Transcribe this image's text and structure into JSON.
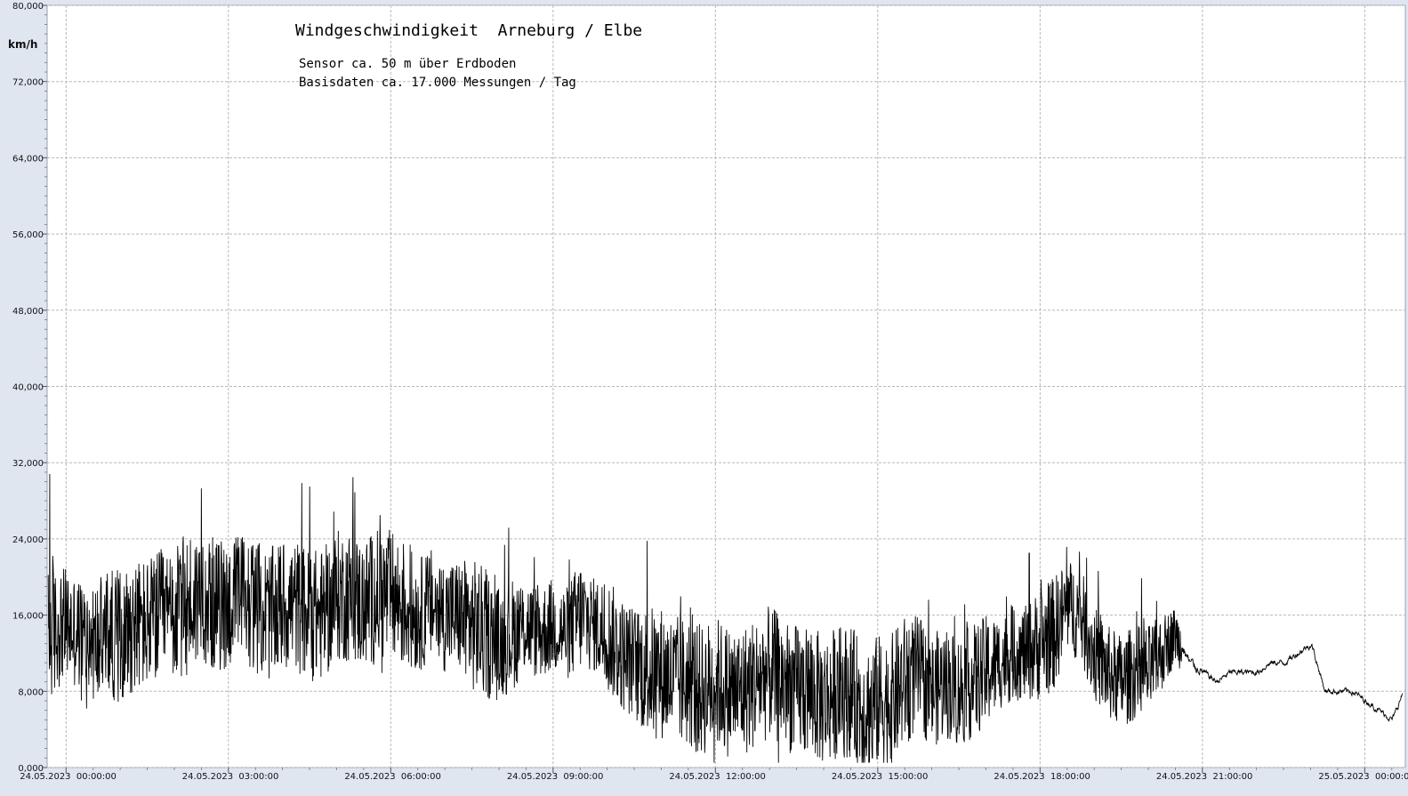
{
  "chart_data": {
    "type": "line",
    "title": "Windgeschwindigkeit  Arneburg / Elbe",
    "subtitle_lines": [
      "Sensor ca. 50 m über Erdboden",
      "Basisdaten ca. 17.000 Messungen / Tag"
    ],
    "ylabel": "km/h",
    "xlabel": "",
    "ylim": [
      0,
      80
    ],
    "y_ticks": [
      "0,000",
      "8,000",
      "16,000",
      "24,000",
      "32,000",
      "40,000",
      "48,000",
      "56,000",
      "64,000",
      "72,000",
      "80,000"
    ],
    "x_range_hours": [
      -0.35,
      24.75
    ],
    "x_ticks": [
      {
        "hour": 0,
        "label": "24.05.2023  00:00:00"
      },
      {
        "hour": 3,
        "label": "24.05.2023  03:00:00"
      },
      {
        "hour": 6,
        "label": "24.05.2023  06:00:00"
      },
      {
        "hour": 9,
        "label": "24.05.2023  09:00:00"
      },
      {
        "hour": 12,
        "label": "24.05.2023  12:00:00"
      },
      {
        "hour": 15,
        "label": "24.05.2023  15:00:00"
      },
      {
        "hour": 18,
        "label": "24.05.2023  18:00:00"
      },
      {
        "hour": 21,
        "label": "24.05.2023  21:00:00"
      },
      {
        "hour": 24,
        "label": "25.05.2023  00:00:00"
      }
    ],
    "grid": true,
    "series": [
      {
        "color": "#000000",
        "x_hours": [
          -0.33,
          -0.3,
          -0.25,
          -0.2,
          -0.1,
          0,
          0.25,
          0.5,
          0.75,
          1,
          1.25,
          1.5,
          1.75,
          2,
          2.25,
          2.5,
          2.75,
          3,
          3.25,
          3.5,
          3.75,
          4,
          4.25,
          4.5,
          4.75,
          5,
          5.25,
          5.5,
          5.75,
          6,
          6.25,
          6.5,
          6.75,
          7,
          7.25,
          7.5,
          7.75,
          8,
          8.25,
          8.5,
          8.75,
          9,
          9.25,
          9.5,
          9.75,
          10,
          10.25,
          10.5,
          10.75,
          11,
          11.25,
          11.5,
          11.75,
          12,
          12.25,
          12.5,
          12.75,
          13,
          13.25,
          13.5,
          13.75,
          14,
          14.25,
          14.5,
          14.75,
          15,
          15.25,
          15.5,
          15.75,
          16,
          16.25,
          16.5,
          16.75,
          17,
          17.25,
          17.5,
          17.75,
          18,
          18.25,
          18.5,
          18.75,
          19,
          19.25,
          19.5,
          19.75,
          20,
          20.25,
          20.5,
          20.75,
          21,
          21.25,
          21.5,
          21.75,
          22,
          22.25,
          22.5,
          22.75,
          23,
          23.25,
          23.5,
          23.75,
          24,
          24.25,
          24.5,
          24.7
        ],
        "mean_kmh": [
          14,
          13,
          15,
          14,
          15,
          15,
          14,
          13,
          14,
          14,
          15,
          15,
          16,
          16,
          17,
          18,
          17,
          17,
          18,
          17,
          16,
          17,
          17,
          16,
          16,
          18,
          18,
          17,
          18,
          18,
          17,
          16,
          17,
          16,
          16,
          15,
          14,
          13,
          14,
          15,
          14,
          15,
          14,
          16,
          15,
          14,
          12,
          11,
          10,
          10,
          9,
          9,
          8,
          9,
          8,
          8,
          9,
          10,
          9,
          8,
          8,
          7,
          8,
          8,
          6,
          7,
          7,
          9,
          10,
          8,
          9,
          8,
          9,
          10,
          11,
          12,
          12,
          13,
          14,
          17,
          16,
          12,
          10,
          9,
          10,
          10,
          12,
          14,
          11,
          10,
          9,
          10,
          10,
          10,
          11,
          11,
          12,
          13,
          8,
          8,
          8,
          7,
          6,
          5,
          8,
          11,
          7
        ],
        "spread_kmh": [
          7,
          6,
          8,
          7,
          6,
          6,
          6,
          6,
          7,
          7,
          7,
          7,
          7,
          7,
          8,
          7,
          7,
          7,
          7,
          7,
          7,
          7,
          7,
          7,
          7,
          7,
          7,
          7,
          7,
          7,
          7,
          6,
          6,
          6,
          6,
          7,
          7,
          6,
          6,
          5,
          5,
          5,
          5,
          6,
          5,
          6,
          6,
          6,
          7,
          7,
          7,
          7,
          7,
          7,
          7,
          7,
          7,
          7,
          7,
          7,
          7,
          7,
          7,
          7,
          7,
          7,
          7,
          7,
          6,
          6,
          6,
          6,
          6,
          6,
          5,
          5,
          5,
          6,
          6,
          5,
          5,
          5,
          5,
          5,
          5,
          5,
          4,
          3,
          2,
          1.2,
          1,
          1,
          1,
          1,
          1,
          1,
          1,
          1.2,
          1,
          1,
          1,
          1,
          1,
          1,
          1,
          1,
          1
        ],
        "peaks": [
          {
            "hour": -0.3,
            "kmh": 30.8
          },
          {
            "hour": 2.5,
            "kmh": 29.3
          },
          {
            "hour": 4.5,
            "kmh": 29.5
          },
          {
            "hour": 5.8,
            "kmh": 26.5
          },
          {
            "hour": 17.8,
            "kmh": 22.5
          },
          {
            "hour": 14.9,
            "kmh": 1
          }
        ]
      }
    ]
  }
}
